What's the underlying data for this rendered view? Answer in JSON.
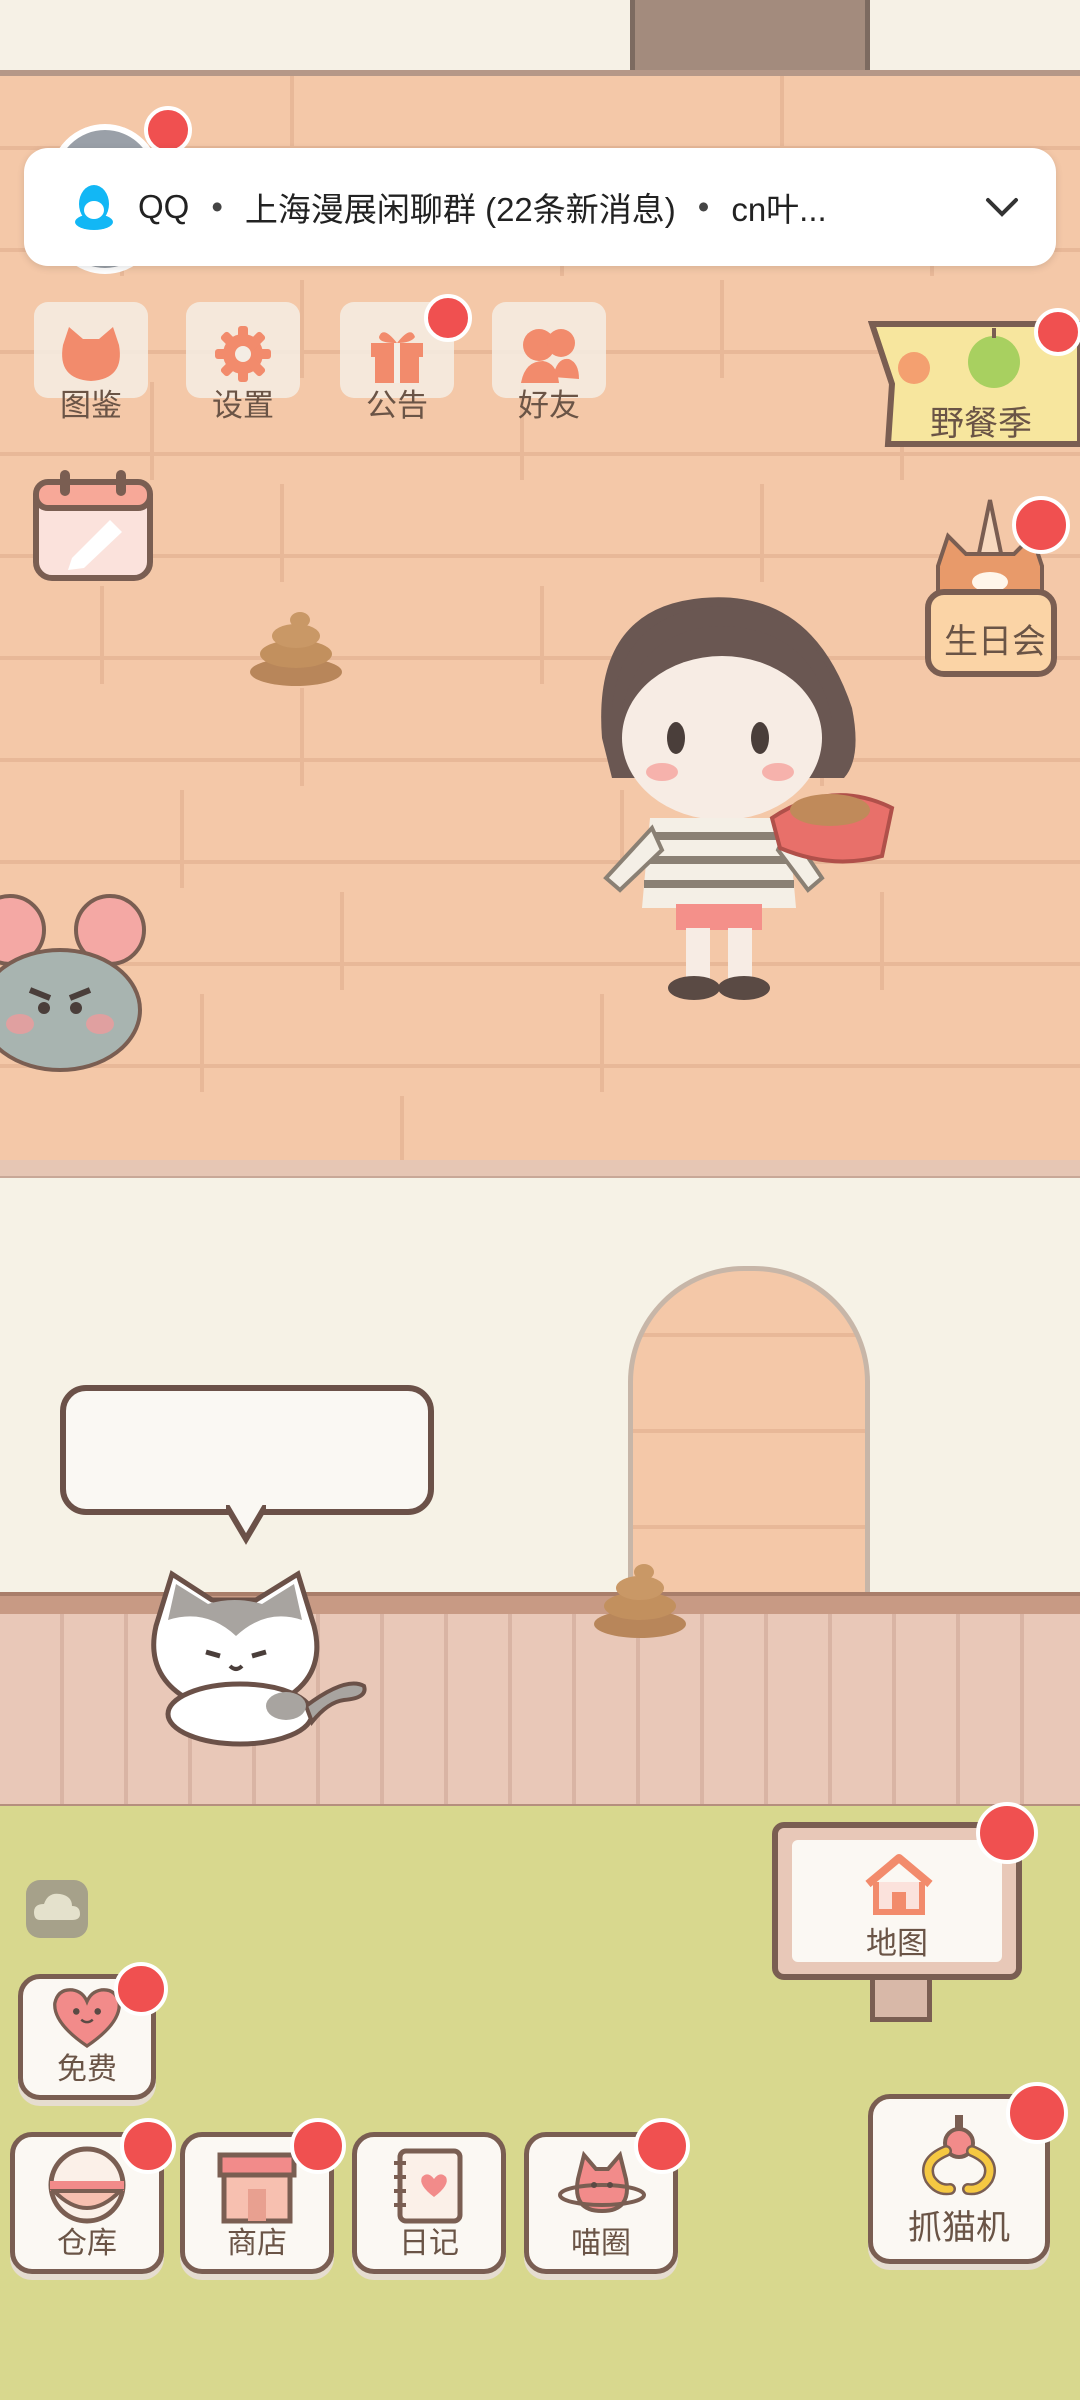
{
  "notification": {
    "app": "QQ",
    "group": "上海漫展闲聊群 (22条新消息)",
    "preview": "cn叶..."
  },
  "top_menu": [
    {
      "label": "图鉴",
      "icon": "cat-head-icon"
    },
    {
      "label": "设置",
      "icon": "gear-icon"
    },
    {
      "label": "公告",
      "icon": "gift-icon"
    },
    {
      "label": "好友",
      "icon": "friends-icon"
    }
  ],
  "events": {
    "picnic": "野餐季",
    "birthday": "生日会"
  },
  "map_sign": "地图",
  "free_button": "免费",
  "bottom_bar": [
    {
      "label": "仓库",
      "icon": "rice-bowl-icon"
    },
    {
      "label": "商店",
      "icon": "shop-icon"
    },
    {
      "label": "日记",
      "icon": "diary-icon"
    },
    {
      "label": "喵圈",
      "icon": "cat-planet-icon"
    }
  ],
  "claw_machine": "抓猫机",
  "colors": {
    "badge": "#f05050",
    "label_text": "#6a5446",
    "wall": "#f4c8a8",
    "grass": "#d8d88e"
  }
}
